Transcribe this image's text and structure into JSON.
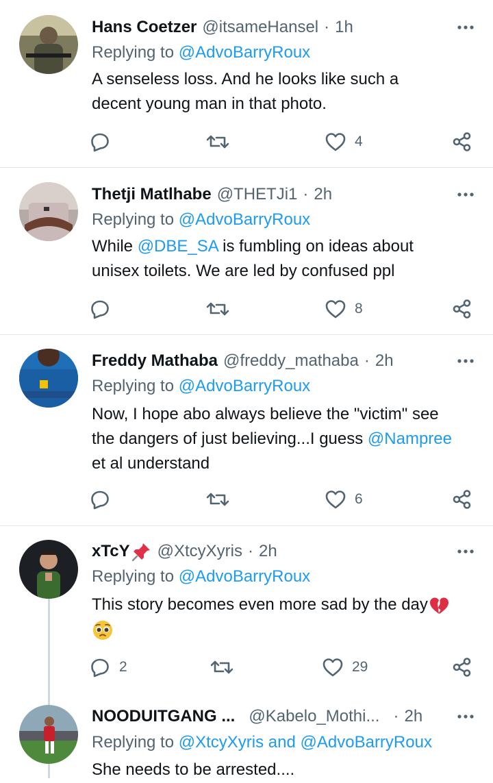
{
  "colors": {
    "text": "#0f1419",
    "secondary": "#536471",
    "link": "#1d9bf0",
    "divider": "#e1e6ea"
  },
  "tweets": [
    {
      "name": "Hans Coetzer",
      "handle": "@itsameHansel",
      "time": "1h",
      "replying_prefix": "Replying to",
      "replying_to": "@AdvoBarryRoux",
      "line1": "A senseless loss. And he looks like such a",
      "line2": "decent young man in that photo.",
      "likes": "4"
    },
    {
      "name": "Thetji Matlhabe",
      "handle": "@THETJi1",
      "time": "2h",
      "replying_prefix": "Replying to",
      "replying_to": "@AdvoBarryRoux",
      "line1_pre": "While ",
      "line1_mention": "@DBE_SA",
      "line1_post": " is fumbling on ideas about",
      "line2": "unisex toilets. We are led by confused ppl",
      "likes": "8"
    },
    {
      "name": "Freddy Mathaba",
      "handle": "@freddy_mathaba",
      "time": "2h",
      "replying_prefix": "Replying to",
      "replying_to": "@AdvoBarryRoux",
      "line1": "Now, I hope abo always believe the \"victim\" see",
      "line2_pre": "the dangers of just believing...I guess ",
      "line2_mention": "@Nampree",
      "line3": "et al understand",
      "likes": "6"
    },
    {
      "name": "xTcY",
      "handle": "@XtcyXyris",
      "time": "2h",
      "replying_prefix": "Replying to",
      "replying_to": "@AdvoBarryRoux",
      "line1": "This story becomes even more sad by the day",
      "replies": "2",
      "likes": "29"
    },
    {
      "name": "NOODUITGANG ...",
      "handle": "@Kabelo_Mothi...",
      "time": "2h",
      "replying_prefix": "Replying to",
      "replying_to": "@XtcyXyris",
      "replying_and": "and",
      "replying_to2": "@AdvoBarryRoux",
      "line1": "She needs to be arrested...."
    }
  ],
  "meta": {
    "dot": "·",
    "more_icon": "more-dots-icon"
  }
}
